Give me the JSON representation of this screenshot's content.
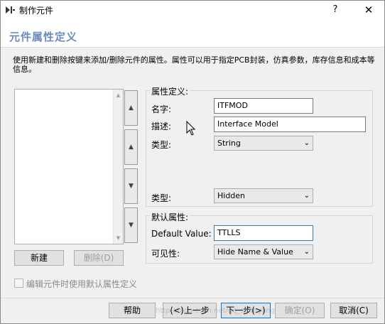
{
  "window": {
    "title": "制作元件",
    "help_label": "?",
    "close_label": "✕"
  },
  "header": {
    "title": "元件属性定义",
    "description": "使用新建和删除按键来添加/删除元件的属性。属性可以用于指定PCB封装，仿真参数，库存信息和成本等信息。"
  },
  "list": {
    "new_button": "新建",
    "delete_button": "删除(D)",
    "move_top": "▲",
    "move_up": "▲",
    "move_down": "▼",
    "move_bottom": "▼"
  },
  "attr_def": {
    "group_label": "属性定义:",
    "name_label": "名字:",
    "name_value": "ITFMOD",
    "desc_label": "描述:",
    "desc_value": "Interface Model",
    "type_label": "类型:",
    "type_value": "String",
    "type2_label": "类型:",
    "type2_value": "Hidden"
  },
  "default_attr": {
    "group_label": "默认属性:",
    "default_value_label": "Default Value:",
    "default_value": "TTLLS",
    "visibility_label": "可见性:",
    "visibility_value": "Hide Name & Value"
  },
  "options": {
    "use_default_checkbox": "编辑元件时使用默认属性定义"
  },
  "footer": {
    "help": "帮助",
    "back": "(<)上一步",
    "next": "下一步(>)",
    "ok": "确定(O)",
    "cancel": "取消(C)",
    "watermark": "http://blog.csdn.net/qq_shaoyang"
  }
}
